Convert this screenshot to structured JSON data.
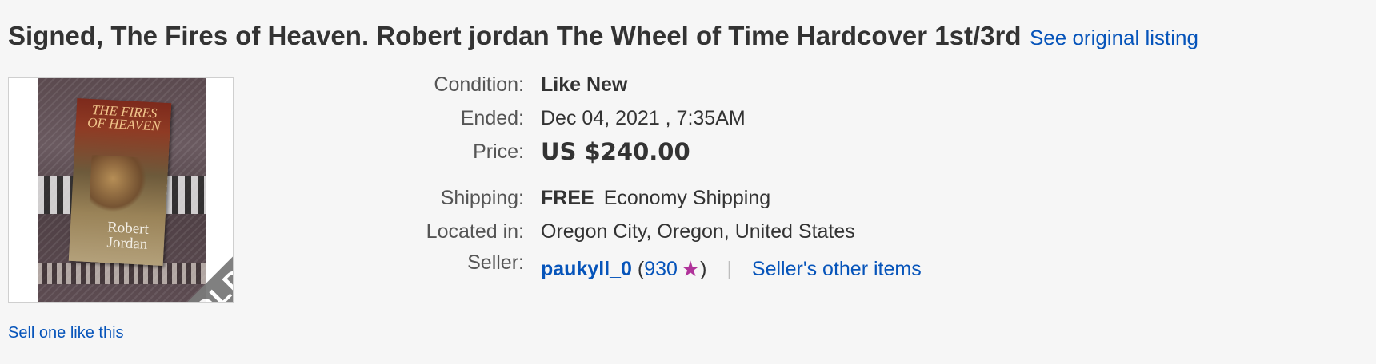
{
  "listing": {
    "title": "Signed, The Fires of Heaven. Robert jordan The Wheel of Time Hardcover 1st/3rd",
    "see_original_label": "See original listing",
    "sell_one_label": "Sell one like this"
  },
  "image": {
    "cover_title": "THE FIRES OF HEAVEN",
    "cover_author": "Robert Jordan",
    "ribbon": "SOLD"
  },
  "details": {
    "condition_label": "Condition:",
    "condition_value": "Like New",
    "ended_label": "Ended:",
    "ended_value": "Dec 04, 2021 , 7:35AM",
    "price_label": "Price:",
    "price_value": "US $240.00",
    "shipping_label": "Shipping:",
    "shipping_free": "FREE",
    "shipping_method": "Economy Shipping",
    "located_label": "Located in:",
    "located_value": "Oregon City, Oregon, United States",
    "seller_label": "Seller:",
    "seller_name": "paukyll_0",
    "seller_open_paren": "(",
    "seller_feedback": "930",
    "seller_close_paren": ")",
    "seller_separator": "|",
    "seller_other_items": "Seller's other items"
  },
  "colors": {
    "link": "#0654ba",
    "text": "#333333",
    "label": "#555555",
    "star": "#b0339a",
    "background": "#f6f6f6"
  },
  "icons": {
    "feedback_star": "star-icon"
  }
}
